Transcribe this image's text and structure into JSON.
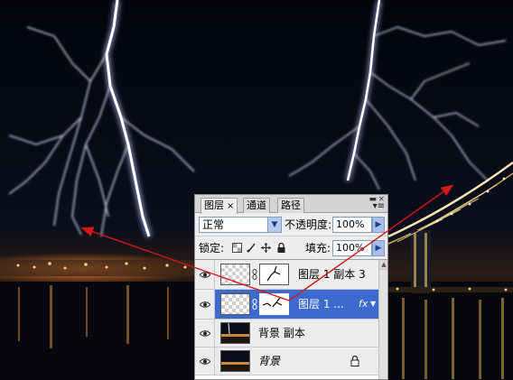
{
  "layers_panel": {
    "tabs": [
      {
        "label": "图层",
        "close": "×"
      },
      {
        "label": "通道"
      },
      {
        "label": "路径"
      }
    ],
    "window_buttons": {
      "minimize": "▬",
      "close": "×"
    },
    "menu_icon": "menu-icon",
    "blend_mode": "正常",
    "opacity_label": "不透明度:",
    "opacity_value": "100%",
    "lock_label": "锁定:",
    "fill_label": "填充:",
    "fill_value": "100%",
    "layers": [
      {
        "name": "图层 1 副本 3",
        "visible": true,
        "selected": false,
        "has_mask": true,
        "transparent_thumb": true
      },
      {
        "name": "图层 1 ...",
        "visible": true,
        "selected": true,
        "has_mask": true,
        "transparent_thumb": true,
        "effects": "fx"
      },
      {
        "name": "背景 副本",
        "visible": true,
        "selected": false,
        "has_mask": false,
        "transparent_thumb": false
      },
      {
        "name": "背景",
        "visible": true,
        "selected": false,
        "has_mask": false,
        "transparent_thumb": false,
        "locked": true
      }
    ]
  },
  "colors": {
    "selection": "#3c6ad1",
    "annotation_arrow": "#d01818",
    "sky": "#05070e",
    "lightning_glow": "#c8d2ff"
  }
}
